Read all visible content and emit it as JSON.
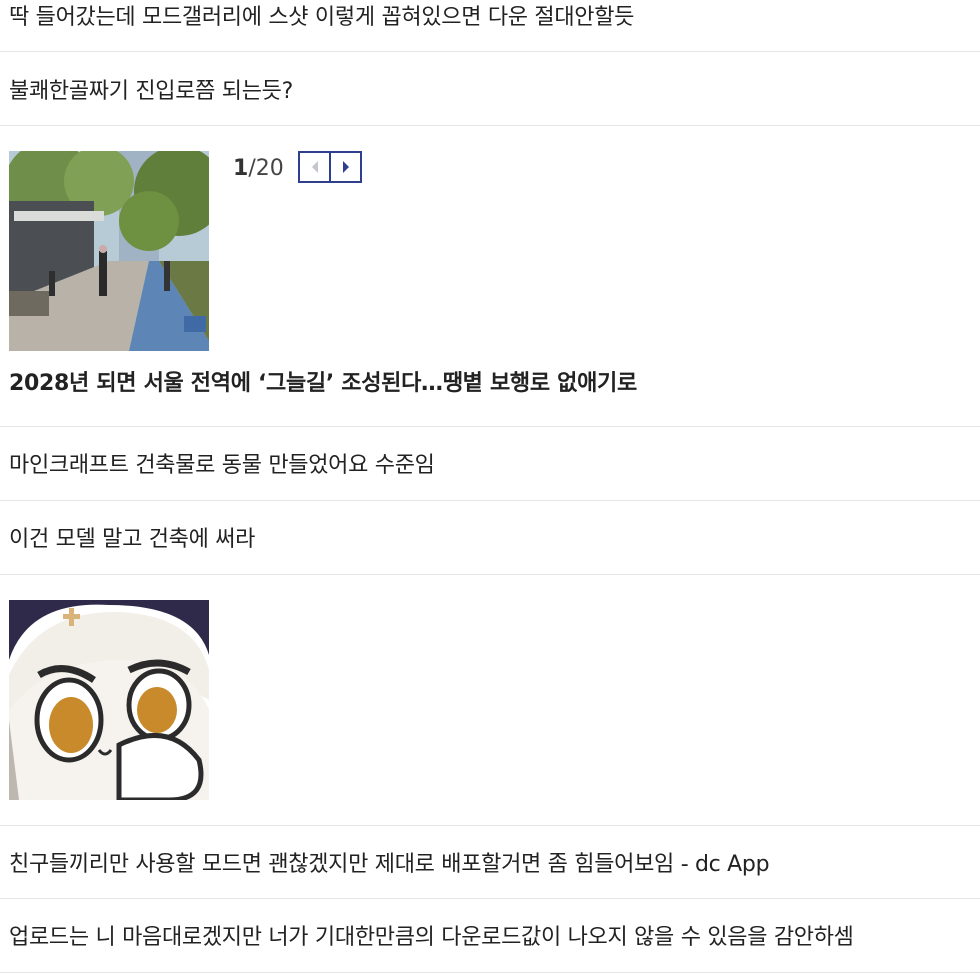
{
  "posts": [
    {
      "text": "딱 들어갔는데 모드갤러리에 스샷 이렇게 꼽혀있으면 다운 절대안할듯"
    },
    {
      "text": "불쾌한골짜기 진입로쯤 되는듯?"
    },
    {
      "text": "2028년 되면 서울 전역에 ‘그늘길’ 조성된다…땡볕 보행로 없애기로"
    },
    {
      "text": "마인크래프트 건축물로 동물 만들었어요 수준임"
    },
    {
      "text": "이건 모델 말고 건축에 써라"
    },
    {
      "text": "친구들끼리만 사용할 모드면 괜찮겠지만 제대로 배포할거면 좀 힘들어보임 - dc App"
    },
    {
      "text": "업로드는 니 마음대로겠지만 너가 기대한만큼의 다운로드값이 나오지 않을 수 있음을 감안하셈"
    }
  ],
  "gallery": {
    "current": "1",
    "total": "/20"
  },
  "icons": {
    "prev": "chevron-left-icon",
    "next": "chevron-right-icon"
  },
  "colors": {
    "pager_border": "#2f3f8f",
    "divider": "#e6e6e6"
  }
}
